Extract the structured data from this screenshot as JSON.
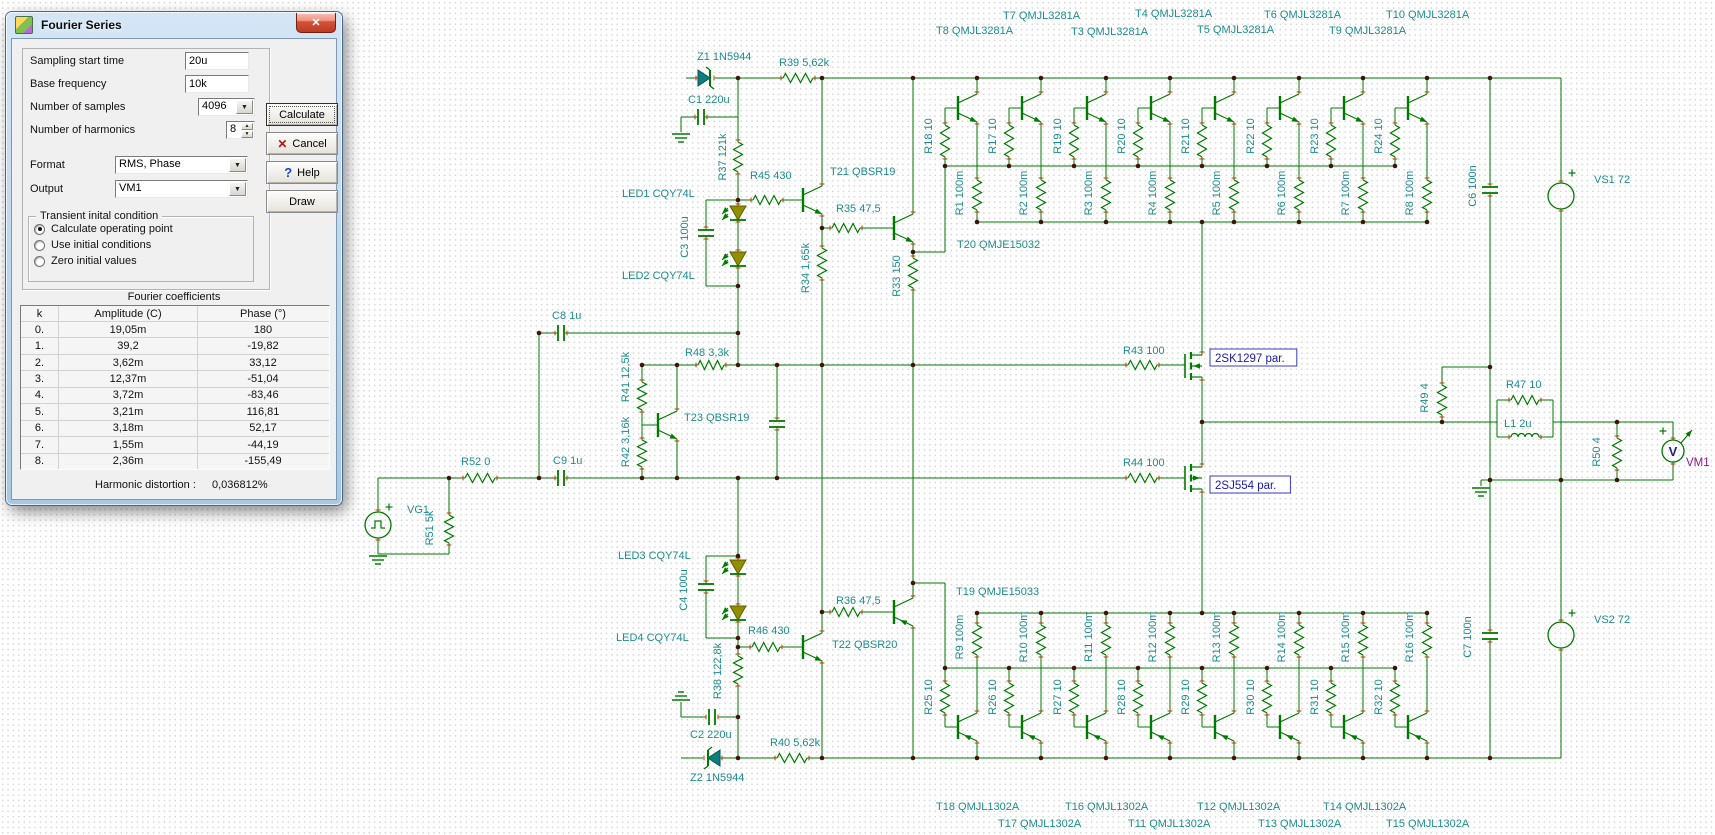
{
  "dialog": {
    "title": "Fourier Series",
    "icons": {
      "close": "✕",
      "cancel": "✕",
      "help": "?",
      "dropdown": "▼",
      "spin_up": "▲",
      "spin_down": "▼"
    },
    "fields": [
      {
        "label": "Sampling start time",
        "value": "20u"
      },
      {
        "label": "Base frequency",
        "value": "10k"
      },
      {
        "label": "Number of samples",
        "value": "4096"
      },
      {
        "label": "Number of harmonics",
        "value": "8"
      },
      {
        "label": "Format",
        "value": "RMS, Phase"
      },
      {
        "label": "Output",
        "value": "VM1"
      }
    ],
    "buttons": {
      "calculate": "Calculate",
      "cancel": "Cancel",
      "help": "Help",
      "draw": "Draw"
    },
    "radio_group": {
      "legend": "Transient inital condition",
      "options": [
        "Calculate operating point",
        "Use initial conditions",
        "Zero initial values"
      ],
      "selected": 0
    },
    "coeff_header": "Fourier coefficients",
    "table": {
      "columns": [
        "k",
        "Amplitude (C)",
        "Phase (°)"
      ],
      "rows": [
        [
          "0.",
          "19,05m",
          "180"
        ],
        [
          "1.",
          "39,2",
          "-19,82"
        ],
        [
          "2.",
          "3,62m",
          "33,12"
        ],
        [
          "3.",
          "12,37m",
          "-51,04"
        ],
        [
          "4.",
          "3,72m",
          "-83,46"
        ],
        [
          "5.",
          "3,21m",
          "116,81"
        ],
        [
          "6.",
          "3,18m",
          "52,17"
        ],
        [
          "7.",
          "1,55m",
          "-44,19"
        ],
        [
          "8.",
          "2,36m",
          "-155,49"
        ]
      ]
    },
    "distortion_label": "Harmonic distortion :",
    "distortion_value": "0,036812%"
  },
  "schematic": {
    "colors": {
      "wire": "#007a00",
      "label": "#1d8c8c",
      "junction": "#3d140a",
      "pin": "#c83200",
      "boxed": "#1a1aa8",
      "meter": "#8b1a8b"
    },
    "labels_h": [
      [
        "Z1 1N5944",
        697,
        50
      ],
      [
        "R39 5,62k",
        779,
        56
      ],
      [
        "C1 220u",
        688,
        93
      ],
      [
        "R45 430",
        750,
        169
      ],
      [
        "T21 QBSR19",
        830,
        165
      ],
      [
        "LED1 CQY74L",
        622,
        187
      ],
      [
        "R35 47,5",
        836,
        202
      ],
      [
        "T20 QMJE15032",
        957,
        238
      ],
      [
        "LED2 CQY74L",
        622,
        269
      ],
      [
        "C8 1u",
        552,
        309
      ],
      [
        "R48 3,3k",
        685,
        346
      ],
      [
        "T23 QBSR19",
        684,
        411
      ],
      [
        "R52 0",
        461,
        455
      ],
      [
        "C9 1u",
        553,
        454
      ],
      [
        "VG1",
        407,
        503
      ],
      [
        "R43 100",
        1123,
        344
      ],
      [
        "R44 100",
        1123,
        456
      ],
      [
        "R47 10",
        1506,
        378
      ],
      [
        "L1 2u",
        1504,
        417
      ],
      [
        "VS1 72",
        1594,
        173
      ],
      [
        "VS2 72",
        1594,
        613
      ],
      [
        "LED3 CQY74L",
        618,
        549
      ],
      [
        "LED4 CQY74L",
        616,
        631
      ],
      [
        "R46 430",
        748,
        624
      ],
      [
        "R36 47,5",
        836,
        594
      ],
      [
        "T22 QBSR20",
        832,
        638
      ],
      [
        "T19 QMJE15033",
        956,
        585
      ],
      [
        "C2 220u",
        690,
        728
      ],
      [
        "R40 5,62k",
        770,
        736
      ],
      [
        "Z2 1N5944",
        690,
        771
      ],
      [
        "T7 QMJL3281A",
        1003,
        9
      ],
      [
        "T4 QMJL3281A",
        1135,
        7
      ],
      [
        "T6 QMJL3281A",
        1264,
        8
      ],
      [
        "T10 QMJL3281A",
        1386,
        8
      ],
      [
        "T8 QMJL3281A",
        936,
        24
      ],
      [
        "T3 QMJL3281A",
        1071,
        25
      ],
      [
        "T5 QMJL3281A",
        1197,
        23
      ],
      [
        "T9 QMJL3281A",
        1329,
        24
      ],
      [
        "T18 QMJL1302A",
        936,
        800
      ],
      [
        "T16 QMJL1302A",
        1065,
        800
      ],
      [
        "T12 QMJL1302A",
        1197,
        800
      ],
      [
        "T14 QMJL1302A",
        1323,
        800
      ],
      [
        "T17 QMJL1302A",
        998,
        817
      ],
      [
        "T11 QMJL1302A",
        1128,
        817
      ],
      [
        "T13 QMJL1302A",
        1258,
        817
      ],
      [
        "T15 QMJL1302A",
        1386,
        817
      ]
    ],
    "labels_v": [
      [
        "R37 121k",
        726,
        157
      ],
      [
        "C3 100u",
        688,
        237
      ],
      [
        "R34 1,65k",
        809,
        268
      ],
      [
        "R33 150",
        900,
        276
      ],
      [
        "R41 12,5k",
        629,
        377
      ],
      [
        "R42 3,16k",
        629,
        442
      ],
      [
        "R51 5k",
        433,
        528
      ],
      [
        "R38 122,8k",
        721,
        671
      ],
      [
        "C4 100u",
        687,
        590
      ],
      [
        "C6 100n",
        1476,
        186
      ],
      [
        "C7 100n",
        1471,
        637
      ],
      [
        "R49 4",
        1428,
        398
      ],
      [
        "R50 4",
        1600,
        452
      ],
      [
        "R18 10",
        932,
        136
      ],
      [
        "R17 10",
        996,
        136
      ],
      [
        "R19 10",
        1061,
        136
      ],
      [
        "R20 10",
        1125,
        136
      ],
      [
        "R21 10",
        1189,
        136
      ],
      [
        "R22 10",
        1254,
        136
      ],
      [
        "R23 10",
        1318,
        136
      ],
      [
        "R24 10",
        1382,
        136
      ],
      [
        "R1 100m",
        963,
        193
      ],
      [
        "R2 100m",
        1027,
        193
      ],
      [
        "R3 100m",
        1092,
        193
      ],
      [
        "R4 100m",
        1156,
        193
      ],
      [
        "R5 100m",
        1220,
        193
      ],
      [
        "R6 100m",
        1285,
        193
      ],
      [
        "R7 100m",
        1349,
        193
      ],
      [
        "R8 100m",
        1413,
        193
      ],
      [
        "R9 100m",
        963,
        637
      ],
      [
        "R10 100m",
        1027,
        637
      ],
      [
        "R11 100m",
        1092,
        637
      ],
      [
        "R12 100m",
        1156,
        637
      ],
      [
        "R13 100m",
        1220,
        637
      ],
      [
        "R14 100m",
        1285,
        637
      ],
      [
        "R15 100m",
        1349,
        637
      ],
      [
        "R16 100m",
        1413,
        637
      ],
      [
        "R25 10",
        932,
        697
      ],
      [
        "R26 10",
        996,
        697
      ],
      [
        "R27 10",
        1061,
        697
      ],
      [
        "R28 10",
        1125,
        697
      ],
      [
        "R29 10",
        1189,
        697
      ],
      [
        "R30 10",
        1254,
        697
      ],
      [
        "R31 10",
        1318,
        697
      ],
      [
        "R32 10",
        1382,
        697
      ]
    ],
    "boxed_labels": [
      [
        "2SK1297 par.",
        1210,
        349
      ],
      [
        "2SJ554 par.",
        1210,
        476
      ]
    ],
    "meter_label": [
      "VM1",
      1686,
      456
    ],
    "meter_glyph": "V"
  }
}
